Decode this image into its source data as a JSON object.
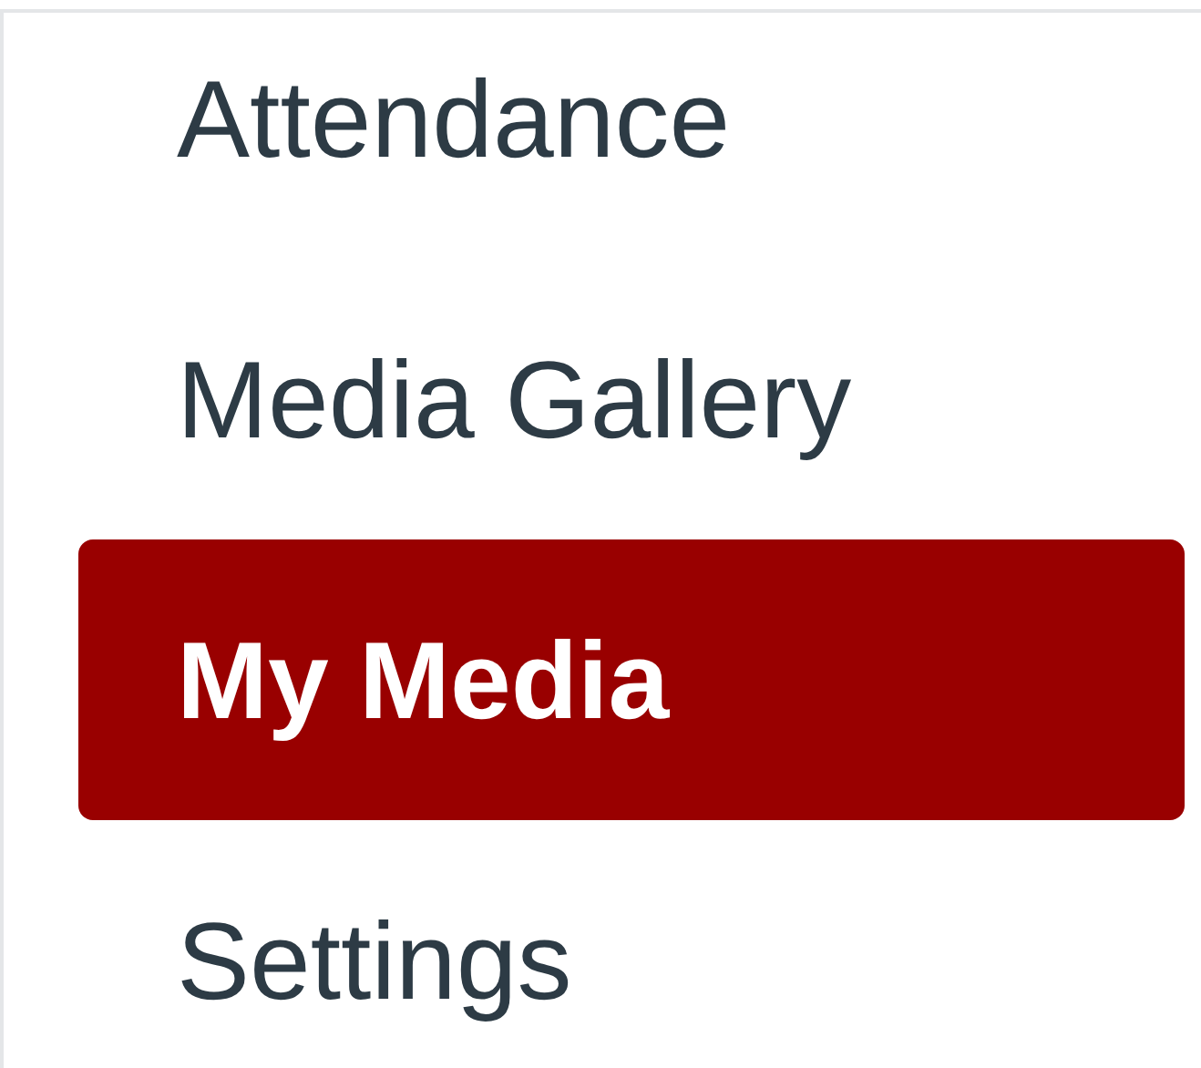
{
  "nav": {
    "items": [
      {
        "label": "Attendance",
        "selected": false
      },
      {
        "label": "Media Gallery",
        "selected": false
      },
      {
        "label": "My Media",
        "selected": true
      },
      {
        "label": "Settings",
        "selected": false
      }
    ]
  }
}
